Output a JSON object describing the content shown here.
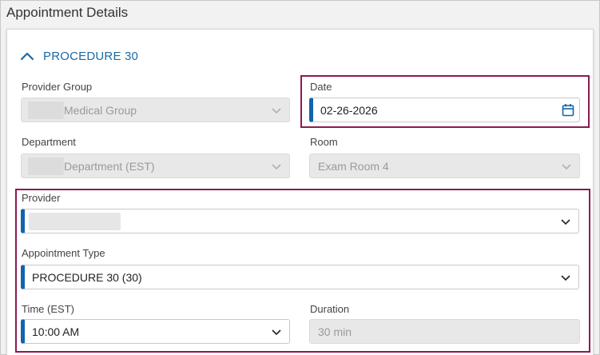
{
  "page": {
    "title": "Appointment Details"
  },
  "section": {
    "title": "PROCEDURE 30",
    "collapse_icon": "chevron-up-icon"
  },
  "provider_group": {
    "label": "Provider Group",
    "value": "Medical Group",
    "disabled": true
  },
  "date": {
    "label": "Date",
    "value": "02-26-2026",
    "icon": "calendar-icon"
  },
  "department": {
    "label": "Department",
    "value": "Department (EST)",
    "disabled": true
  },
  "room": {
    "label": "Room",
    "value": "Exam Room 4",
    "disabled": true
  },
  "provider": {
    "label": "Provider",
    "value": ""
  },
  "appointment_type": {
    "label": "Appointment Type",
    "value": "PROCEDURE 30 (30)"
  },
  "time": {
    "label": "Time (EST)",
    "value": "10:00 AM"
  },
  "duration": {
    "label": "Duration",
    "value": "30 min",
    "disabled": true
  },
  "colors": {
    "accent_blue": "#1164ad",
    "link_blue": "#1a6aa6",
    "callout_border": "#8b1a52",
    "disabled_bg": "#e8e8e8"
  }
}
